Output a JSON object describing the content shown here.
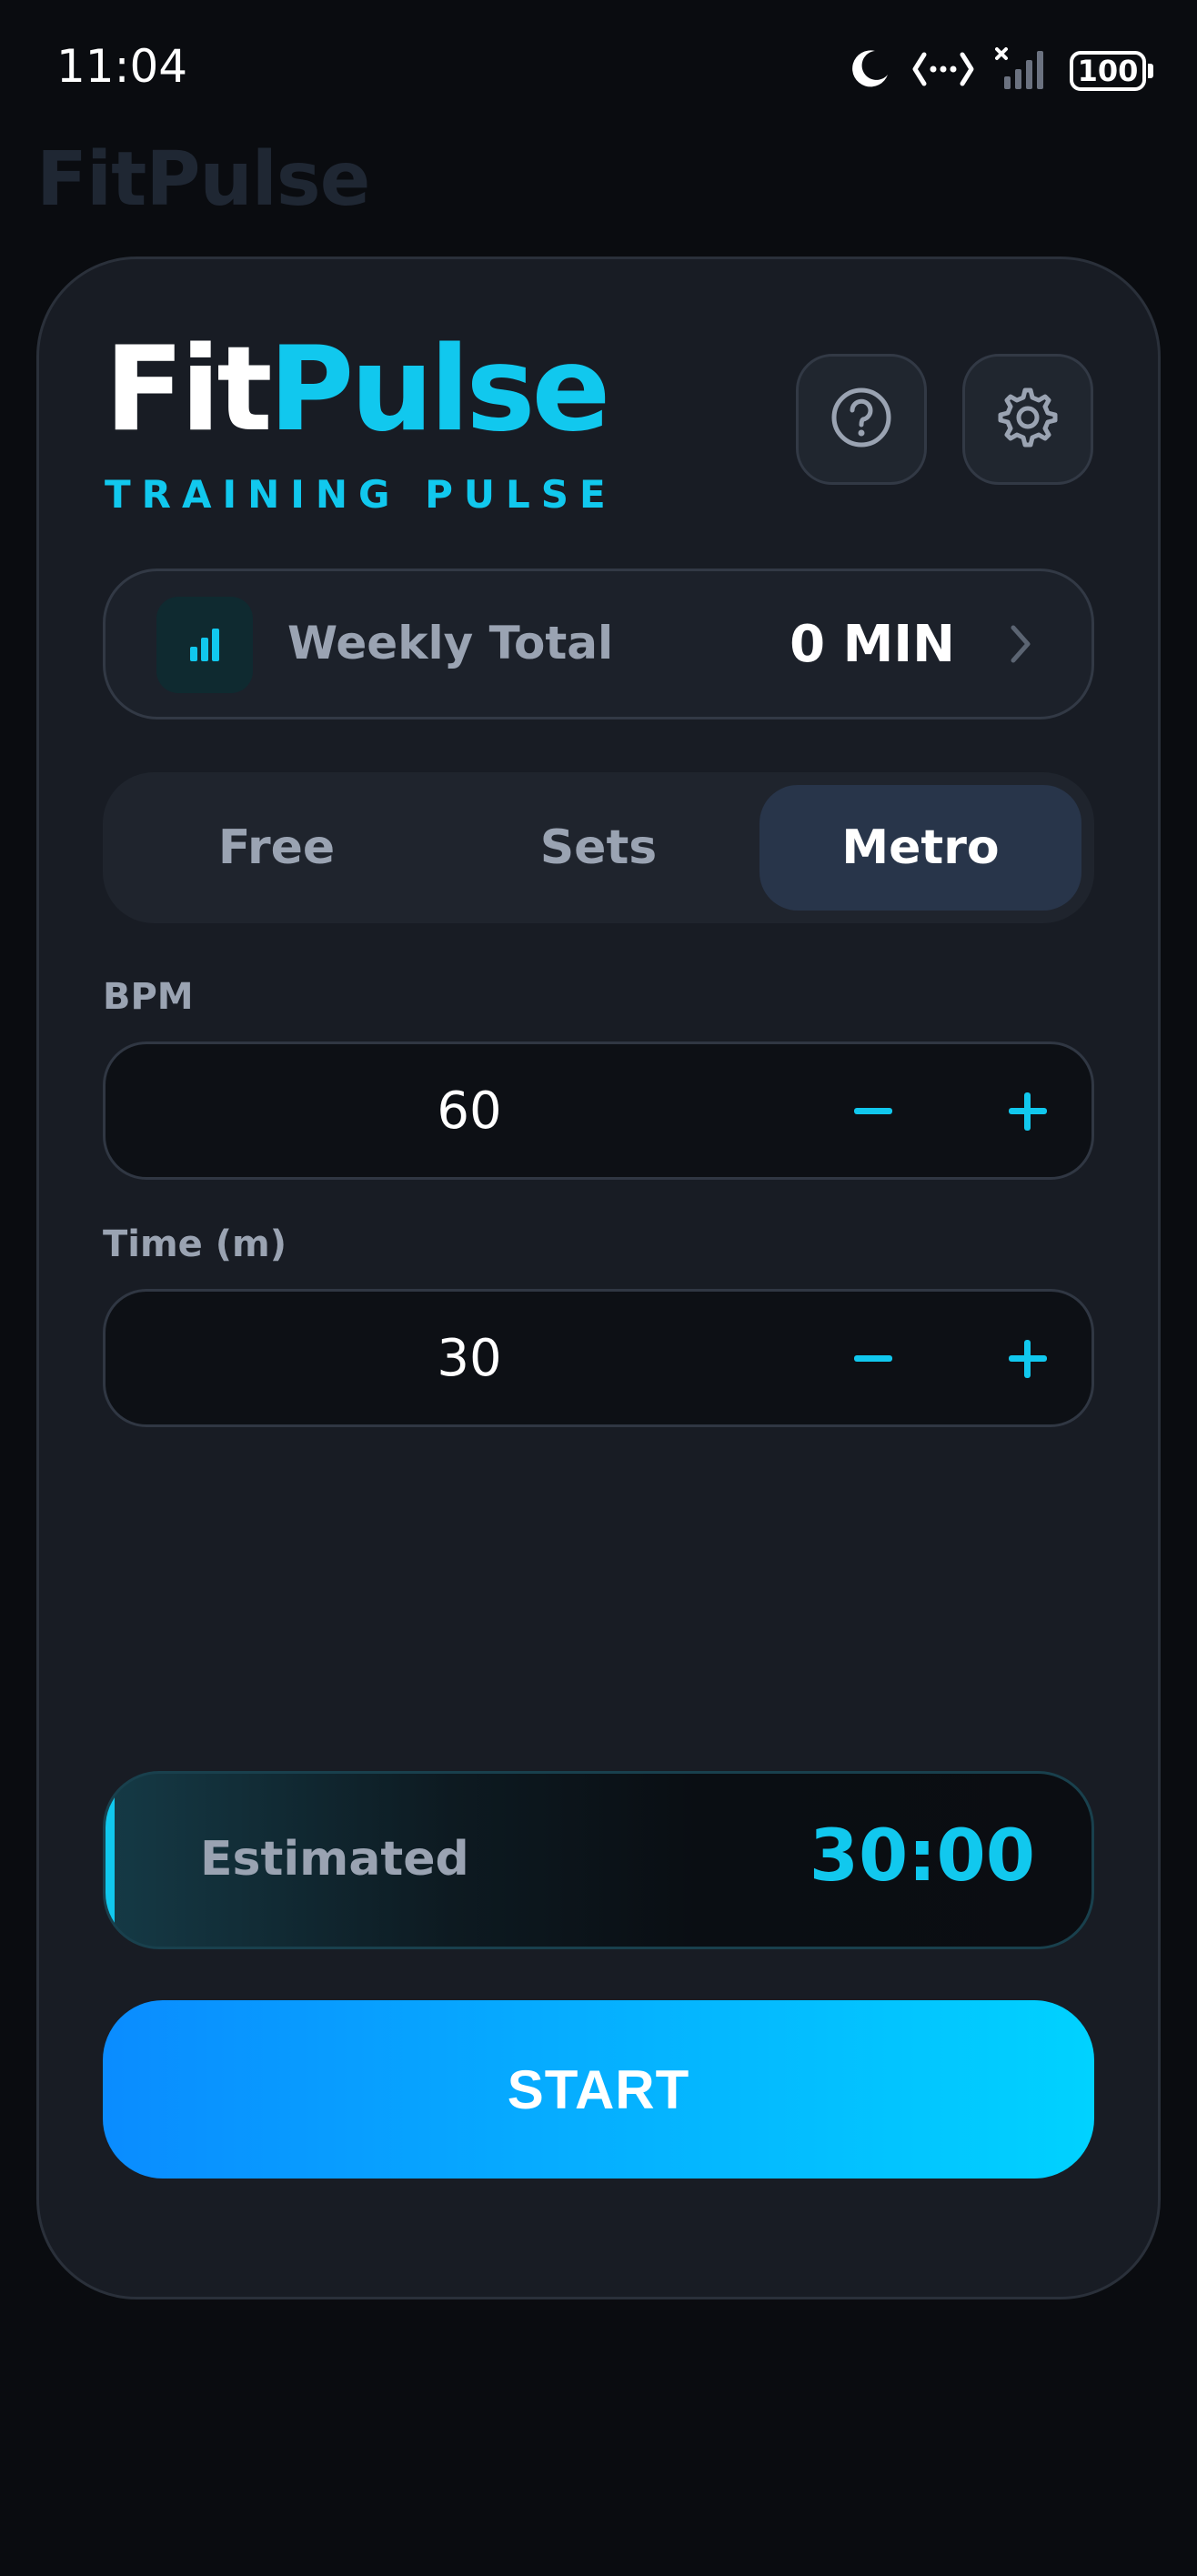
{
  "status_bar": {
    "time": "11:04",
    "battery": "100",
    "icons": [
      "moon-icon",
      "data-sync-icon",
      "signal-icon",
      "battery-icon"
    ]
  },
  "header": {
    "ghost_title": "FitPulse",
    "brand_fit": "Fit",
    "brand_pulse": "Pulse",
    "subtitle": "TRAINING PULSE",
    "help_icon": "help-circle-icon",
    "settings_icon": "gear-icon"
  },
  "weekly": {
    "label": "Weekly Total",
    "value": "0 MIN",
    "icon": "bar-chart-icon"
  },
  "tabs": [
    {
      "label": "Free",
      "active": false
    },
    {
      "label": "Sets",
      "active": false
    },
    {
      "label": "Metro",
      "active": true
    }
  ],
  "fields": {
    "bpm": {
      "label": "BPM",
      "value": "60"
    },
    "time": {
      "label": "Time (m)",
      "value": "30"
    }
  },
  "estimated": {
    "label": "Estimated",
    "value": "30:00"
  },
  "start_label": "START",
  "colors": {
    "accent": "#11c8ee",
    "background": "#0a0c10",
    "card": "#181c24",
    "active_tab": "#28354a",
    "start_gradient_start": "#0a8cff",
    "start_gradient_end": "#00d2ff"
  }
}
